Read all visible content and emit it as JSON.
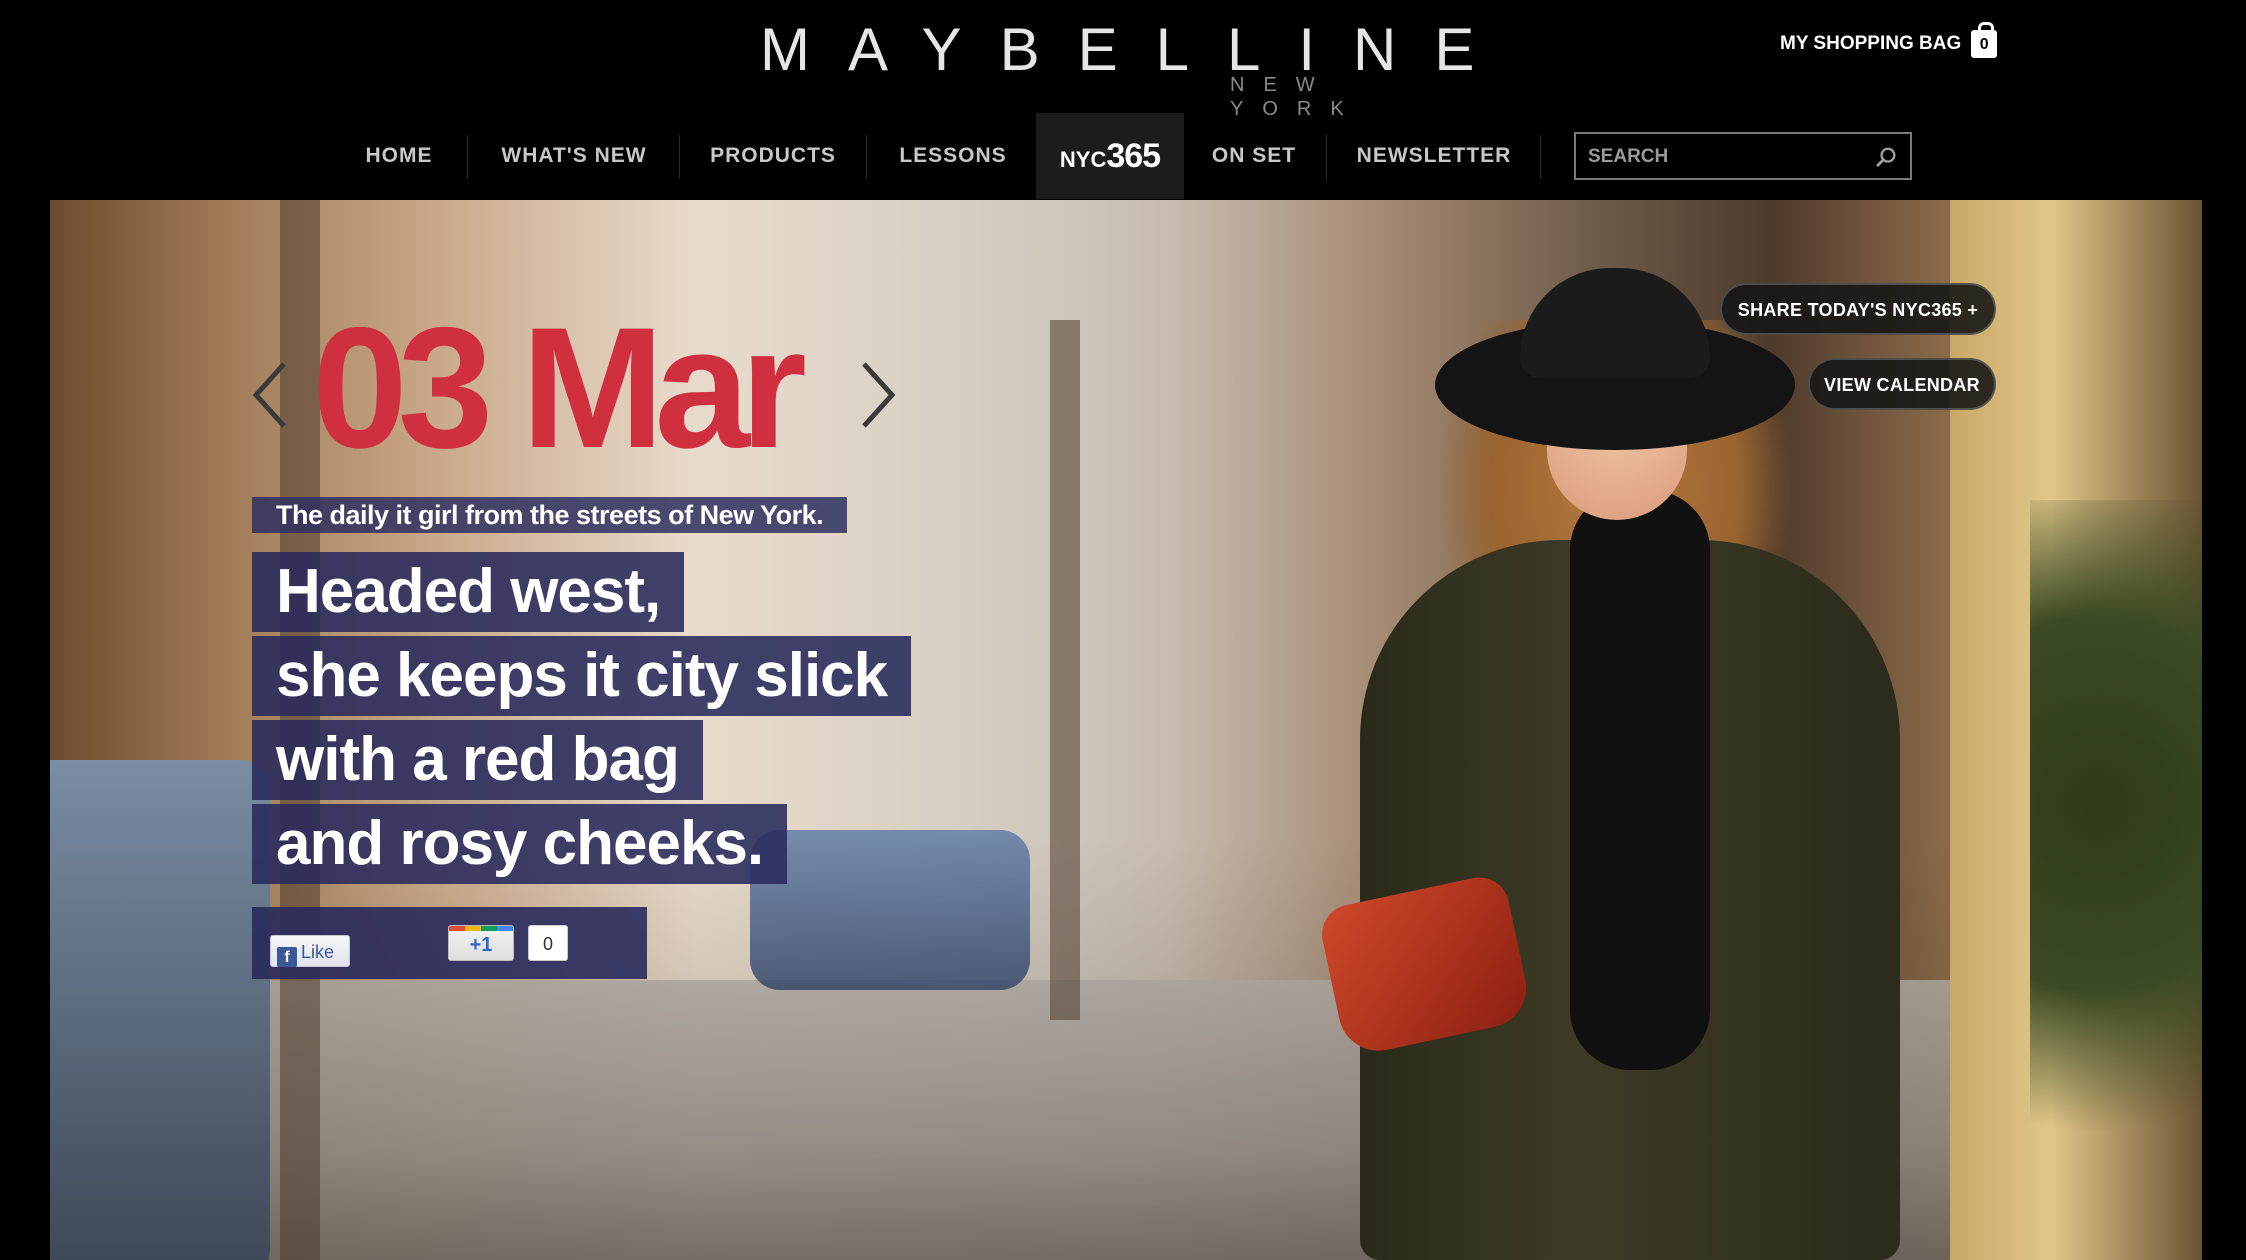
{
  "header": {
    "brand": "MAYBELLINE",
    "brand_sub": "NEW YORK",
    "bag_label": "MY SHOPPING BAG",
    "bag_count": "0"
  },
  "nav": {
    "items": [
      {
        "label": "HOME"
      },
      {
        "label": "WHAT'S NEW"
      },
      {
        "label": "PRODUCTS"
      },
      {
        "label": "LESSONS"
      },
      {
        "label_a": "NYC",
        "label_b": "365",
        "active": true
      },
      {
        "label": "ON SET"
      },
      {
        "label": "NEWSLETTER"
      }
    ],
    "search_placeholder": "SEARCH"
  },
  "hero": {
    "date": "03 Mar",
    "tagline": "The daily it girl from the streets of New York.",
    "lines": [
      "Headed west,",
      "she keeps it city slick",
      "with a red bag",
      "and rosy cheeks."
    ],
    "share_button": "SHARE TODAY'S NYC365 +",
    "calendar_button": "VIEW CALENDAR",
    "fb_like": "Like",
    "gplus_label": "+1",
    "gplus_count": "0"
  },
  "colors": {
    "date_red": "#cf2f3f",
    "caption_bg": "#2a2c5c",
    "background": "#000000"
  }
}
